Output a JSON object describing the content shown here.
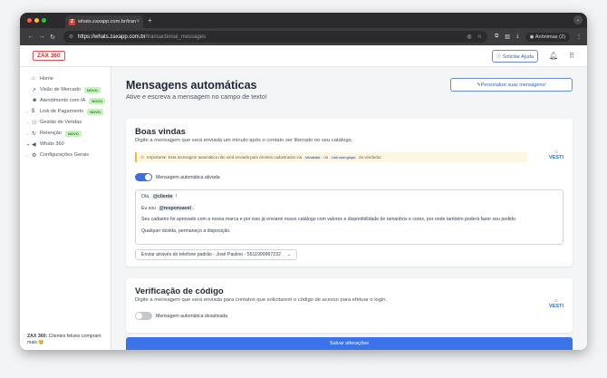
{
  "browser": {
    "tab_title": "whats.zaxapp.com.br/transa...",
    "tab_close": "×",
    "new_tab": "+",
    "url_domain": "https://whats.zaxapp.com.br",
    "url_path": "/transactional_messages",
    "profile_label": "Anônimas (2)",
    "favicon_letter": "Z"
  },
  "app": {
    "logo": "ZAX 360",
    "help_button": "Solicitar Ajuda"
  },
  "sidebar": {
    "items": [
      {
        "label": "Home",
        "icon": "home-icon",
        "glyph": "⌂",
        "arrow": "",
        "badge": ""
      },
      {
        "label": "Visão de Mercado",
        "icon": "trend-icon",
        "glyph": "↗",
        "arrow": "",
        "badge": "NOVO"
      },
      {
        "label": "Atendimento com IA",
        "icon": "robot-icon",
        "glyph": "☻",
        "arrow": "",
        "badge": "NOVO"
      },
      {
        "label": "Link de Pagamento",
        "icon": "dollar-icon",
        "glyph": "$",
        "arrow": "›",
        "badge": "NOVO"
      },
      {
        "label": "Gestão de Vendas",
        "icon": "users-icon",
        "glyph": "⚇",
        "arrow": "›",
        "badge": ""
      },
      {
        "label": "Retenção",
        "icon": "refresh-icon",
        "glyph": "↻",
        "arrow": "›",
        "badge": "NOVO"
      },
      {
        "label": "Whats 360",
        "icon": "megaphone-icon",
        "glyph": "◀",
        "arrow": "▾",
        "badge": ""
      },
      {
        "label": "Configurações Gerais",
        "icon": "settings-icon",
        "glyph": "⚙",
        "arrow": "›",
        "badge": ""
      }
    ],
    "promo_bold": "ZAX 360:",
    "promo_text": " Clientes felizes compram mais 😊"
  },
  "main": {
    "title": "Mensagens automáticas",
    "subtitle": "Ative e escreva a mensagem no campo de texto!",
    "personalize_button": "Personalize suas mensagens!"
  },
  "welcome_card": {
    "title": "Boas vindas",
    "description": "Digite a mensagem que será enviada um minuto após o contato ser liberado no seu catálogo.",
    "partner": "VESTI",
    "warning_prefix": "Importante: Esta mensagem automática não será enviada para clientes cadastrados via",
    "warning_chip1": "Vendedor",
    "warning_mid": "ou",
    "warning_chip2": "Link com grupo",
    "warning_suffix": "do vendedor.",
    "toggle_label": "Mensagem automática ativada",
    "toggle_on": true,
    "msg_greeting": "Olá,",
    "msg_tag_cliente": "@cliente",
    "msg_greeting_end": "!",
    "msg_line2_prefix": "Eu sou",
    "msg_tag_responsavel": "@responsavel",
    "msg_line2_end": ".",
    "msg_line3": "Seu cadastro foi aprovado com a nossa marca e por isso já enviarei nosso catálogo com valores e disponibilidade de tamanhos e cores, por onde também poderá fazer seu pedido.",
    "msg_line4": "Qualquer dúvida, permaneço a disposição.",
    "send_via": "Enviar através do telefone padrão - José Paulino - 5511999967232"
  },
  "verify_card": {
    "title": "Verificação de código",
    "description": "Digite a mensagem que será enviada para contatos que solicitarem o código de acesso para efetuar o login.",
    "partner": "VESTI",
    "toggle_label": "Mensagem automática desativada",
    "toggle_on": false
  },
  "save_button": "Salvar alterações"
}
